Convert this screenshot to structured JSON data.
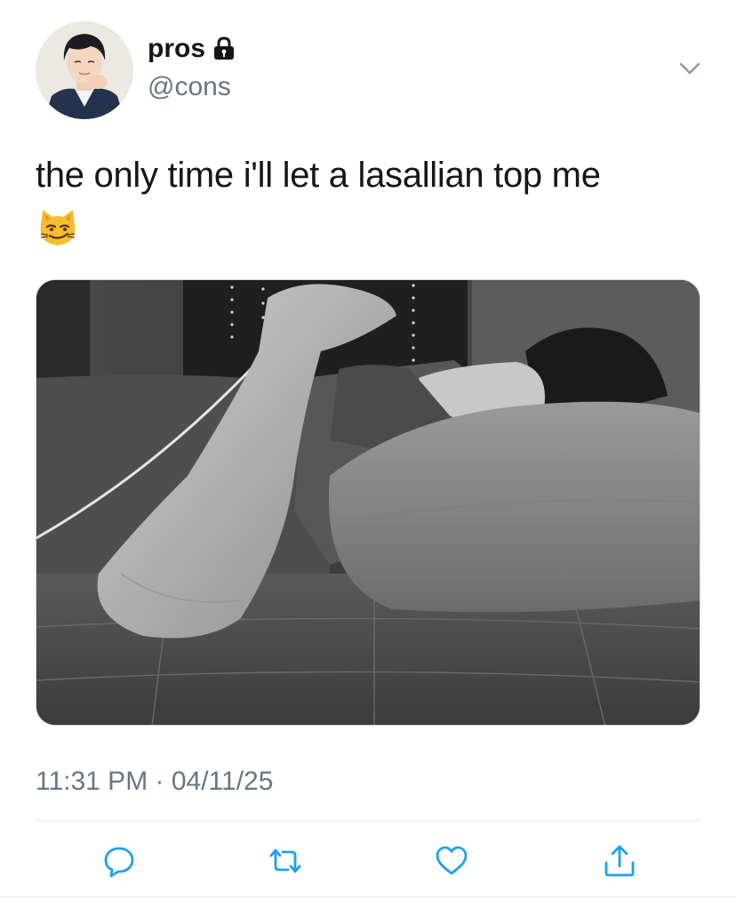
{
  "tweet": {
    "display_name": "pros",
    "handle": "@cons",
    "text": "the only time i'll let a lasallian top me",
    "emoji": "smirking-cat-face",
    "timestamp": "11:31 PM · 04/11/25",
    "protected": true
  },
  "actions": [
    {
      "name": "reply",
      "icon": "reply-icon"
    },
    {
      "name": "retweet",
      "icon": "retweet-icon"
    },
    {
      "name": "like",
      "icon": "heart-icon"
    },
    {
      "name": "share",
      "icon": "share-icon"
    }
  ],
  "colors": {
    "text": "#14171a",
    "secondary": "#657786",
    "icon": "#1da1f2",
    "divider": "#e1e8ed"
  }
}
